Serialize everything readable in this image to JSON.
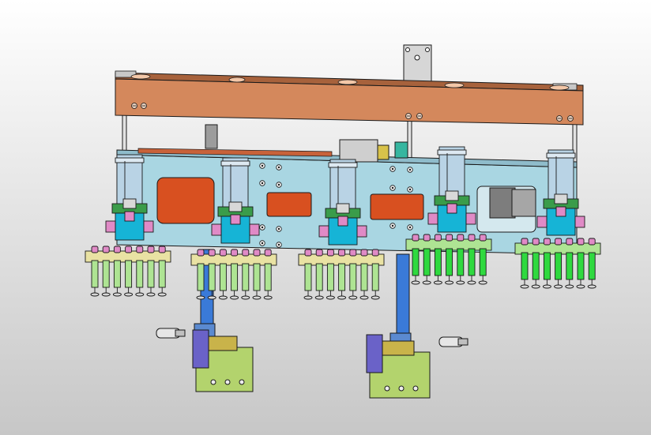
{
  "scene": {
    "background_top": "#ffffff",
    "background_bottom": "#c7c7c7",
    "colors": {
      "beam": "#d4885c",
      "beam_dark": "#a7623c",
      "plate": "#a9d6e2",
      "orange_window": "#d85020",
      "cylinder": "#b9d3e5",
      "cyan_block": "#16b4d6",
      "green_block": "#3a9c4a",
      "light_green": "#aee493",
      "bright_green": "#2fd93f",
      "pink": "#e08ac6",
      "cream": "#e9e2a3",
      "blue_column": "#3a7ad8",
      "lime_base": "#b3d36d",
      "olive_block": "#c9b34a",
      "purple": "#6a62c8",
      "gray": "#9a9a9a",
      "outline": "#1a1a1a"
    },
    "finger_groups": [
      {
        "fingers": 7,
        "style": "light"
      },
      {
        "fingers": 7,
        "style": "light"
      },
      {
        "fingers": 7,
        "style": "light"
      },
      {
        "fingers": 7,
        "style": "bright"
      },
      {
        "fingers": 7,
        "style": "bright"
      }
    ]
  }
}
